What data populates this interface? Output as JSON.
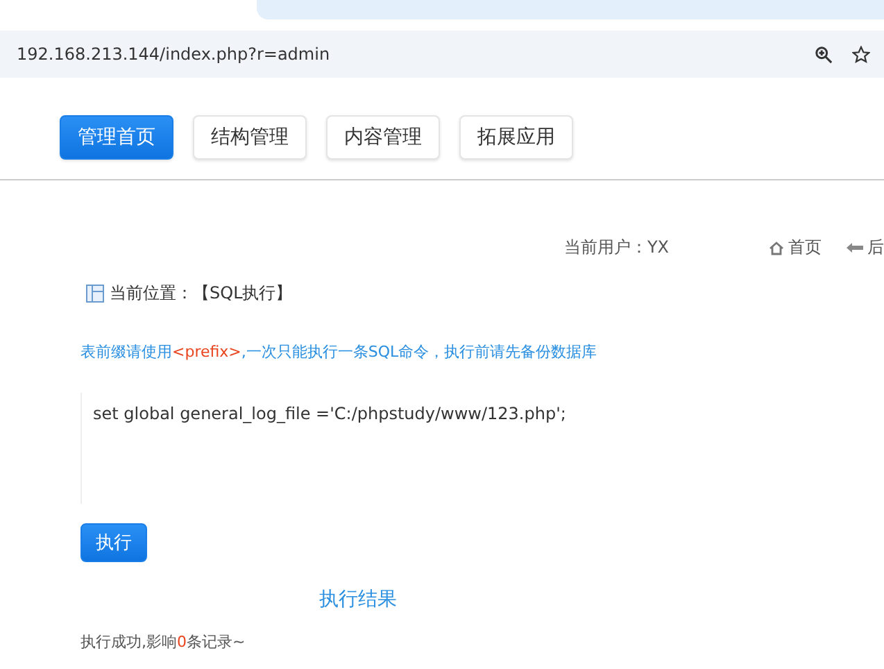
{
  "browser": {
    "url": "192.168.213.144/index.php?r=admin"
  },
  "nav": [
    {
      "label": "管理首页",
      "selected": true
    },
    {
      "label": "结构管理",
      "selected": false
    },
    {
      "label": "内容管理",
      "selected": false
    },
    {
      "label": "拓展应用",
      "selected": false
    }
  ],
  "user_bar": {
    "user": "当前用户：YX",
    "links": [
      "首页",
      "后"
    ]
  },
  "breadcrumb": "当前位置：【SQL执行】",
  "tip": [
    {
      "text": "表前缀请使用",
      "highlight": false
    },
    {
      "text": "<prefix>",
      "highlight": true
    },
    {
      "text": ",一次只能执行一条SQL命令，执行前请先备份数据库",
      "highlight": false
    }
  ],
  "sql_input": {
    "value": "set global general_log_file ='C:/phpstudy/www/123.php';"
  },
  "execute_button": "执行",
  "result": {
    "title": "执行结果",
    "message": [
      {
        "text": "执行成功,影响",
        "highlight": false
      },
      {
        "text": "0",
        "highlight": true
      },
      {
        "text": "条记录~",
        "highlight": false
      }
    ]
  }
}
